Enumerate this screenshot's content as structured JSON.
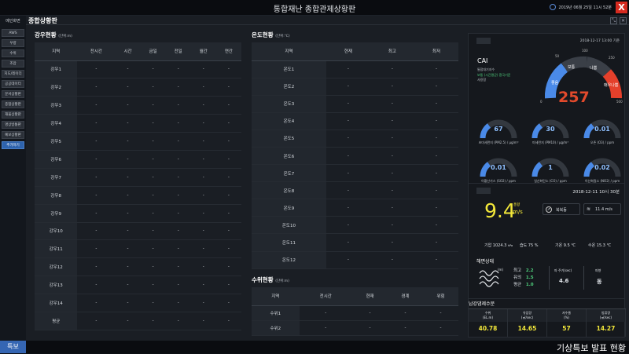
{
  "header": {
    "title": "통합재난 종합관제상황판",
    "datetime": "2019년 06월 25일 11시 52분",
    "close": "X"
  },
  "sidebar": {
    "home": "메인화면",
    "items": [
      "AWS",
      "우량",
      "수위",
      "조압",
      "지도/레이더",
      "공공데이터",
      "문서상황판",
      "종합상황판",
      "재울상황판",
      "명상방통판",
      "예보상황판",
      "추가하기"
    ],
    "active_index": 11
  },
  "main": {
    "title": "종합상황판",
    "btn_expand": "⤡",
    "btn_close": "✕"
  },
  "rain": {
    "title": "강우현황",
    "unit": "(단위:m)",
    "cols": [
      "지역",
      "전시간",
      "시간",
      "금일",
      "전일",
      "월간",
      "연간"
    ],
    "rows": [
      "강우1",
      "강우2",
      "강우3",
      "강우4",
      "강우5",
      "강우6",
      "강우7",
      "강우8",
      "강우9",
      "강우10",
      "강우11",
      "강우12",
      "강우13",
      "강우14",
      "평균"
    ],
    "cell": "-"
  },
  "temp": {
    "title": "온도현황",
    "unit": "(단위:℃)",
    "cols": [
      "지역",
      "현재",
      "최고",
      "최저"
    ],
    "rows": [
      "온도1",
      "온도2",
      "온도3",
      "온도4",
      "온도5",
      "온도6",
      "온도7",
      "온도8",
      "온도9",
      "온도10",
      "온도11",
      "온도12"
    ],
    "cell": "-"
  },
  "water": {
    "title": "수위현황",
    "unit": "(단위:m)",
    "cols": [
      "지역",
      "전시간",
      "현재",
      "경계",
      "위험"
    ],
    "rows": [
      "수위1",
      "수위2"
    ],
    "cell": "-"
  },
  "air": {
    "time": "2018-12-17 13:00 기준",
    "cai_label": "CAI",
    "cai_sub": "통합대기지수",
    "cai_desc1": "보통 (시간평균) 환국기준",
    "cai_desc2": "사용함",
    "cai_value": "257",
    "scale": [
      "좋음",
      "보통",
      "나쁨",
      "매우나쁨"
    ],
    "scale_ticks": [
      "0",
      "50",
      "100",
      "250",
      "500"
    ],
    "gauges": [
      {
        "value": "67",
        "label": "초미세먼지 (PM2.5) / μg/m³"
      },
      {
        "value": "30",
        "label": "미세먼지 (PM10) / μg/m³"
      },
      {
        "value": "0.01",
        "label": "오존 (O3) / ppm"
      },
      {
        "value": "0.01",
        "label": "이황산가스 (SO2) / ppm"
      },
      {
        "value": "1",
        "label": "일산화탄소 (CO) / ppm"
      },
      {
        "value": "0.02",
        "label": "이산화질소 (NO2) / ppm"
      }
    ]
  },
  "weather": {
    "time": "2018-12-11  10시 30분",
    "wind_speed": "9.4",
    "wind_unit": "m/s",
    "wind_label": "풍향",
    "dir": "북북동",
    "gust": "11.4 m/s",
    "pressure_label": "기압",
    "pressure": "1024.3",
    "pressure_unit": "hPa",
    "humid_label": "습도",
    "humid": "75 %",
    "temp_label": "기온",
    "temp": "9.5 ℃",
    "water_label": "수온",
    "water": "15.3 ℃",
    "sea_title": "해면상태",
    "wave_unit": "(m)",
    "wave_rows": [
      {
        "k": "최고",
        "v": "2.2"
      },
      {
        "k": "유의",
        "v": "1.5"
      },
      {
        "k": "평균",
        "v": "1.0"
      }
    ],
    "period_label": "파 주기(sec)",
    "period": "4.6",
    "dir2_label": "파향",
    "dir2": "동"
  },
  "dam": {
    "title": "남강댐제수문",
    "cols": [
      "수위\n(EL.m)",
      "유입량\n(㎥/sec)",
      "저수율\n(%)",
      "방류량\n(㎥/sec)"
    ],
    "values": [
      "40.78",
      "14.65",
      "57",
      "14.27"
    ]
  },
  "footer": {
    "tag": "특보",
    "ticker": "기상특보 발표 현황"
  },
  "colors": {
    "accent": "#3566b3",
    "alert": "#d62a1f",
    "gauge_blue": "#4a8ae8",
    "value_yellow": "#f3e83a"
  }
}
